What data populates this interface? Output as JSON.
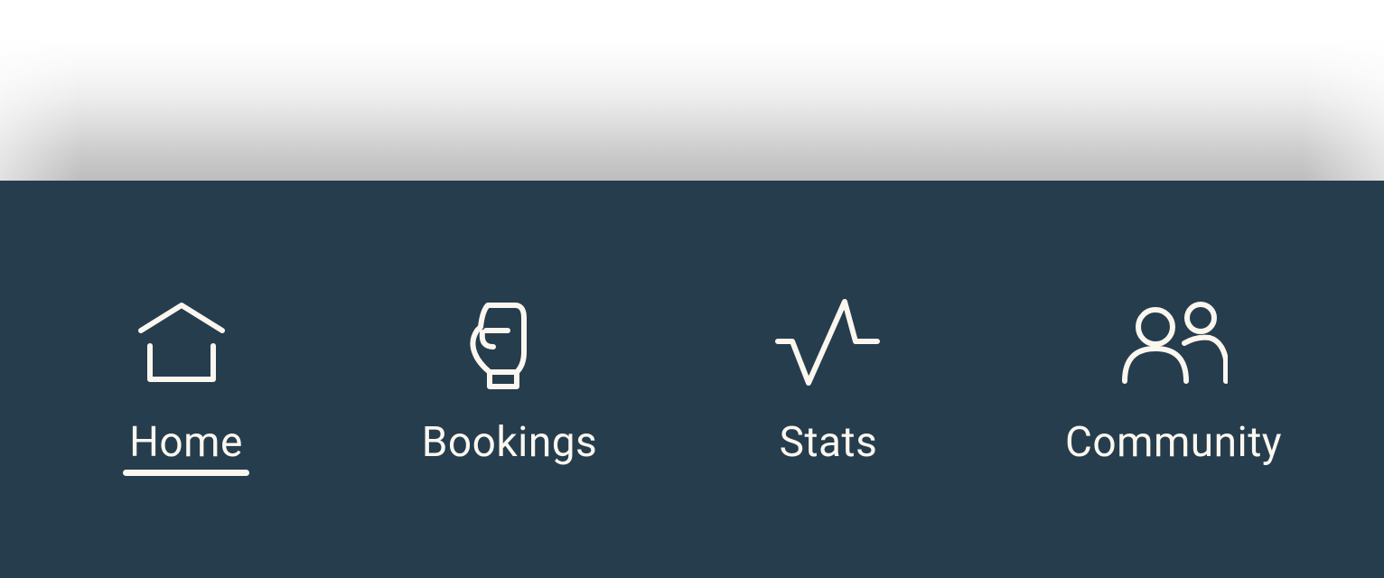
{
  "nav": {
    "items": [
      {
        "label": "Home",
        "icon": "home-icon",
        "active": true
      },
      {
        "label": "Bookings",
        "icon": "boxing-glove-icon",
        "active": false
      },
      {
        "label": "Stats",
        "icon": "activity-pulse-icon",
        "active": false
      },
      {
        "label": "Community",
        "icon": "users-icon",
        "active": false
      }
    ]
  },
  "colors": {
    "navbar_bg": "#263d4e",
    "foreground": "#fbf7ef",
    "page_bg": "#ffffff"
  }
}
